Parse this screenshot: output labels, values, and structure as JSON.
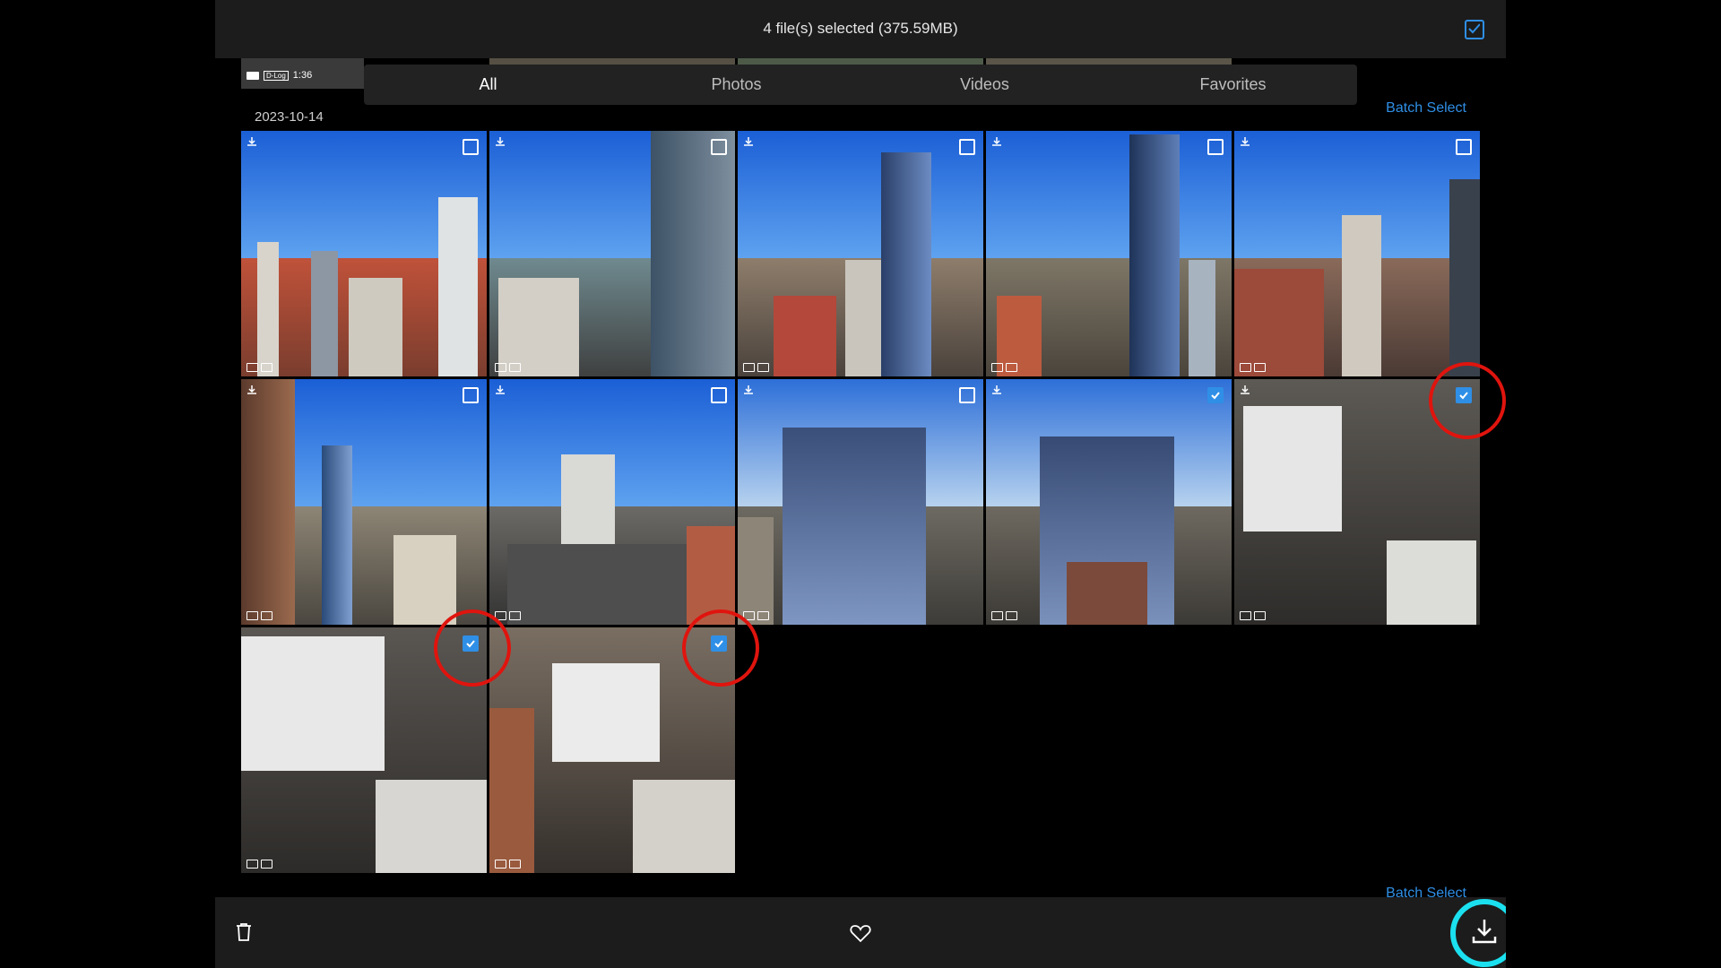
{
  "header": {
    "selection_summary": "4 file(s) selected (375.59MB)",
    "select_all_icon": "checkbox-checked-icon"
  },
  "strip": {
    "duration": "1:36",
    "log_tag": "D-Log"
  },
  "tabs": [
    {
      "label": "All",
      "active": true
    },
    {
      "label": "Photos",
      "active": false
    },
    {
      "label": "Videos",
      "active": false
    },
    {
      "label": "Favorites",
      "active": false
    }
  ],
  "section": {
    "date": "2023-10-14",
    "batch_select": "Batch Select"
  },
  "next_section": {
    "batch_select": "Batch Select"
  },
  "media": [
    {
      "selected": false
    },
    {
      "selected": false
    },
    {
      "selected": false
    },
    {
      "selected": false
    },
    {
      "selected": false
    },
    {
      "selected": false
    },
    {
      "selected": false
    },
    {
      "selected": false
    },
    {
      "selected": true
    },
    {
      "selected": true
    },
    {
      "selected": true
    },
    {
      "selected": true
    }
  ],
  "bottom": {
    "delete_icon": "trash-icon",
    "favorite_icon": "heart-icon",
    "download_icon": "download-icon"
  },
  "colors": {
    "accent": "#2f8fe6",
    "highlight_red": "#e0140e",
    "highlight_cyan": "#1be0ef",
    "bar_bg": "#1c1c1c"
  }
}
